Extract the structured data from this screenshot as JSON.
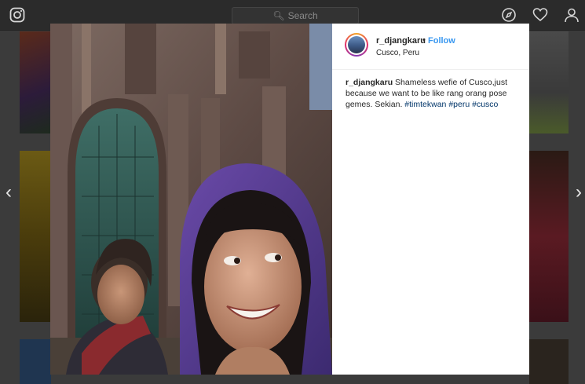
{
  "topbar": {
    "logo_icon": "instagram-logo-icon",
    "search_placeholder": "Search",
    "nav_icons": [
      "compass-explore-icon",
      "heart-activity-icon",
      "person-profile-icon"
    ]
  },
  "arrows": {
    "prev": "‹",
    "next": "›"
  },
  "post": {
    "username": "r_djangkaru",
    "separator": "•",
    "follow_label": "Follow",
    "location": "Cusco, Peru",
    "caption": {
      "author": "r_djangkaru",
      "text": "Shameless wefie of Cusco,just because we want to be like rang orang pose gemes. Sekian.",
      "hashtags": [
        "#timtekwan",
        "#peru",
        "#cusco"
      ]
    }
  },
  "colors": {
    "link_blue": "#3897f0",
    "hashtag": "#003569",
    "text": "#262626"
  }
}
